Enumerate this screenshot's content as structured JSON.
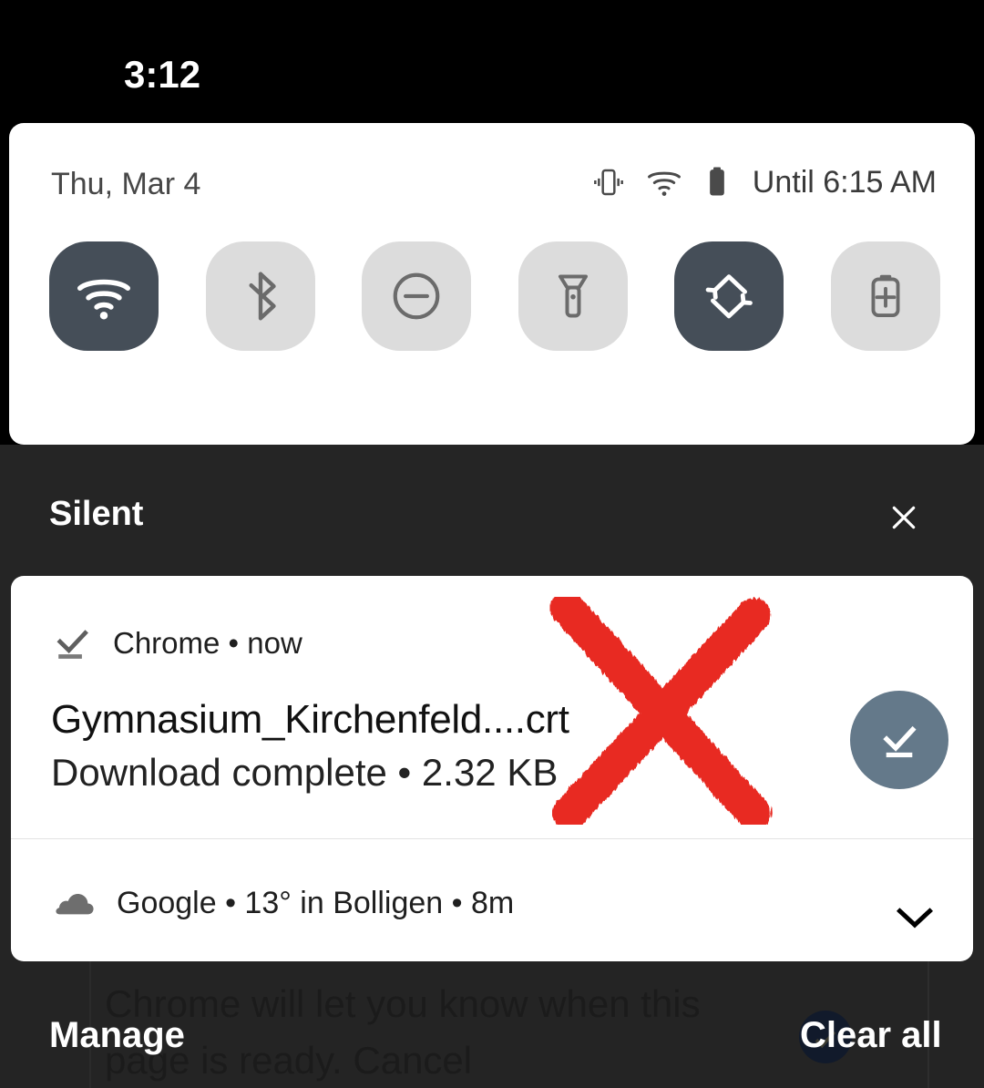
{
  "status_bar": {
    "time": "3:12"
  },
  "quick_settings": {
    "date": "Thu, Mar 4",
    "battery_status": "Until 6:15 AM",
    "status_icons": [
      "vibrate-icon",
      "wifi-icon",
      "battery-icon"
    ],
    "drag_handle": "drag-handle",
    "tiles": [
      {
        "name": "wifi",
        "icon": "wifi-icon",
        "state": "on"
      },
      {
        "name": "bluetooth",
        "icon": "bluetooth-off-icon",
        "state": "off"
      },
      {
        "name": "do-not-disturb",
        "icon": "do-not-disturb-icon",
        "state": "off"
      },
      {
        "name": "flashlight",
        "icon": "flashlight-icon",
        "state": "off"
      },
      {
        "name": "auto-rotate",
        "icon": "auto-rotate-icon",
        "state": "on"
      },
      {
        "name": "battery-saver",
        "icon": "battery-saver-icon",
        "state": "off"
      }
    ],
    "colors": {
      "tile_on": "#454e58",
      "tile_off": "#dcdcdc",
      "panel": "#ffffff"
    }
  },
  "shade": {
    "section_label": "Silent",
    "dismiss_icon": "close-icon",
    "background": "#252525"
  },
  "notifications": [
    {
      "app": "Chrome",
      "time": "now",
      "header": "Chrome • now",
      "icon": "download-complete-icon",
      "title": "Gymnasium_Kirchenfeld....crt",
      "subtitle": "Download complete • 2.32 KB",
      "avatar_icon": "download-complete-icon",
      "avatar_color": "#64798a"
    },
    {
      "app": "Google",
      "header": "Google • 13° in Bolligen • 8m",
      "icon": "cloud-icon",
      "temperature": "13°",
      "location": "Bolligen",
      "time": "8m",
      "expand_icon": "chevron-down-icon"
    }
  ],
  "footer": {
    "manage_label": "Manage",
    "clear_all_label": "Clear all"
  },
  "background_page": {
    "text": "Chrome will let you know when this page is ready. Cancel",
    "badge_icon": "check-icon"
  },
  "annotation": {
    "type": "red-x-mark",
    "color": "#e82b22"
  }
}
